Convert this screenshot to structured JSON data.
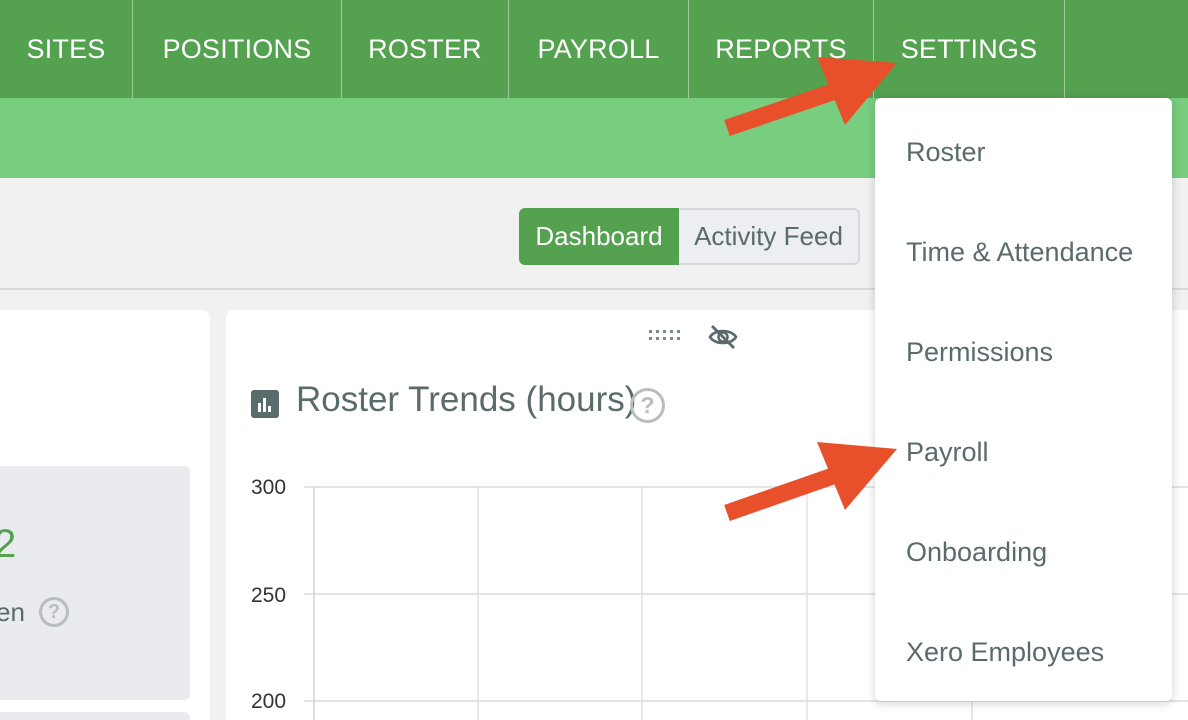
{
  "nav": {
    "items": [
      "SITES",
      "POSITIONS",
      "ROSTER",
      "PAYROLL",
      "REPORTS",
      "SETTINGS"
    ]
  },
  "toolbar": {
    "dashboard_label": "Dashboard",
    "activity_feed_label": "Activity Feed"
  },
  "left_card": {
    "value": "2",
    "label": "en"
  },
  "widget": {
    "title": "Roster Trends (hours)",
    "help_icon": "question-circle-icon",
    "drag_icon": "drag-handle-icon",
    "hide_icon": "eye-slash-icon",
    "title_icon": "bar-chart-icon"
  },
  "chart_data": {
    "type": "line",
    "title": "Roster Trends (hours)",
    "y_ticks": [
      "300",
      "250",
      "200"
    ],
    "ylim": [
      200,
      300
    ],
    "grid": true,
    "series": []
  },
  "settings_menu": {
    "items": [
      "Roster",
      "Time & Attendance",
      "Permissions",
      "Payroll",
      "Onboarding",
      "Xero Employees"
    ]
  },
  "colors": {
    "primary_green": "#54a150",
    "light_green": "#79cd7e",
    "annotation_arrow": "#e8502c"
  }
}
